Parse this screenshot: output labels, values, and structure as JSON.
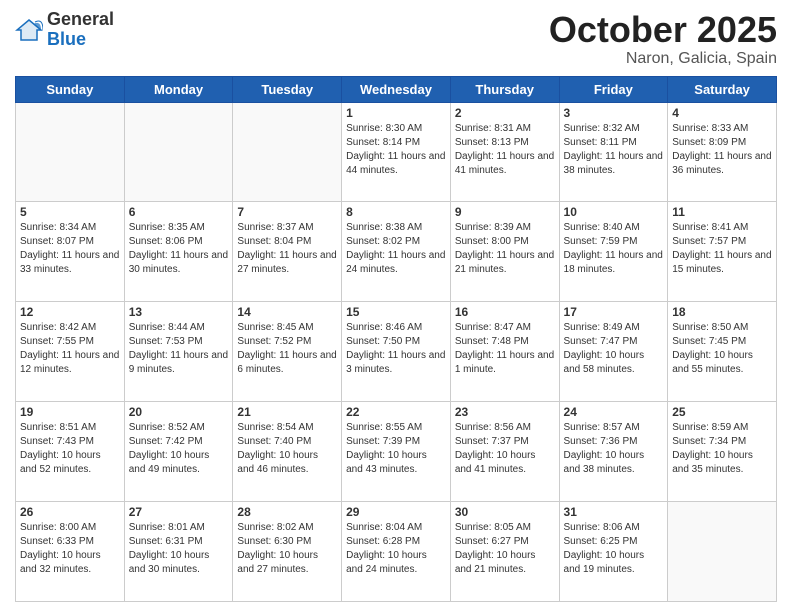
{
  "header": {
    "logo_general": "General",
    "logo_blue": "Blue",
    "title": "October 2025",
    "location": "Naron, Galicia, Spain"
  },
  "days_of_week": [
    "Sunday",
    "Monday",
    "Tuesday",
    "Wednesday",
    "Thursday",
    "Friday",
    "Saturday"
  ],
  "weeks": [
    [
      {
        "day": "",
        "info": ""
      },
      {
        "day": "",
        "info": ""
      },
      {
        "day": "",
        "info": ""
      },
      {
        "day": "1",
        "info": "Sunrise: 8:30 AM\nSunset: 8:14 PM\nDaylight: 11 hours and 44 minutes."
      },
      {
        "day": "2",
        "info": "Sunrise: 8:31 AM\nSunset: 8:13 PM\nDaylight: 11 hours and 41 minutes."
      },
      {
        "day": "3",
        "info": "Sunrise: 8:32 AM\nSunset: 8:11 PM\nDaylight: 11 hours and 38 minutes."
      },
      {
        "day": "4",
        "info": "Sunrise: 8:33 AM\nSunset: 8:09 PM\nDaylight: 11 hours and 36 minutes."
      }
    ],
    [
      {
        "day": "5",
        "info": "Sunrise: 8:34 AM\nSunset: 8:07 PM\nDaylight: 11 hours and 33 minutes."
      },
      {
        "day": "6",
        "info": "Sunrise: 8:35 AM\nSunset: 8:06 PM\nDaylight: 11 hours and 30 minutes."
      },
      {
        "day": "7",
        "info": "Sunrise: 8:37 AM\nSunset: 8:04 PM\nDaylight: 11 hours and 27 minutes."
      },
      {
        "day": "8",
        "info": "Sunrise: 8:38 AM\nSunset: 8:02 PM\nDaylight: 11 hours and 24 minutes."
      },
      {
        "day": "9",
        "info": "Sunrise: 8:39 AM\nSunset: 8:00 PM\nDaylight: 11 hours and 21 minutes."
      },
      {
        "day": "10",
        "info": "Sunrise: 8:40 AM\nSunset: 7:59 PM\nDaylight: 11 hours and 18 minutes."
      },
      {
        "day": "11",
        "info": "Sunrise: 8:41 AM\nSunset: 7:57 PM\nDaylight: 11 hours and 15 minutes."
      }
    ],
    [
      {
        "day": "12",
        "info": "Sunrise: 8:42 AM\nSunset: 7:55 PM\nDaylight: 11 hours and 12 minutes."
      },
      {
        "day": "13",
        "info": "Sunrise: 8:44 AM\nSunset: 7:53 PM\nDaylight: 11 hours and 9 minutes."
      },
      {
        "day": "14",
        "info": "Sunrise: 8:45 AM\nSunset: 7:52 PM\nDaylight: 11 hours and 6 minutes."
      },
      {
        "day": "15",
        "info": "Sunrise: 8:46 AM\nSunset: 7:50 PM\nDaylight: 11 hours and 3 minutes."
      },
      {
        "day": "16",
        "info": "Sunrise: 8:47 AM\nSunset: 7:48 PM\nDaylight: 11 hours and 1 minute."
      },
      {
        "day": "17",
        "info": "Sunrise: 8:49 AM\nSunset: 7:47 PM\nDaylight: 10 hours and 58 minutes."
      },
      {
        "day": "18",
        "info": "Sunrise: 8:50 AM\nSunset: 7:45 PM\nDaylight: 10 hours and 55 minutes."
      }
    ],
    [
      {
        "day": "19",
        "info": "Sunrise: 8:51 AM\nSunset: 7:43 PM\nDaylight: 10 hours and 52 minutes."
      },
      {
        "day": "20",
        "info": "Sunrise: 8:52 AM\nSunset: 7:42 PM\nDaylight: 10 hours and 49 minutes."
      },
      {
        "day": "21",
        "info": "Sunrise: 8:54 AM\nSunset: 7:40 PM\nDaylight: 10 hours and 46 minutes."
      },
      {
        "day": "22",
        "info": "Sunrise: 8:55 AM\nSunset: 7:39 PM\nDaylight: 10 hours and 43 minutes."
      },
      {
        "day": "23",
        "info": "Sunrise: 8:56 AM\nSunset: 7:37 PM\nDaylight: 10 hours and 41 minutes."
      },
      {
        "day": "24",
        "info": "Sunrise: 8:57 AM\nSunset: 7:36 PM\nDaylight: 10 hours and 38 minutes."
      },
      {
        "day": "25",
        "info": "Sunrise: 8:59 AM\nSunset: 7:34 PM\nDaylight: 10 hours and 35 minutes."
      }
    ],
    [
      {
        "day": "26",
        "info": "Sunrise: 8:00 AM\nSunset: 6:33 PM\nDaylight: 10 hours and 32 minutes."
      },
      {
        "day": "27",
        "info": "Sunrise: 8:01 AM\nSunset: 6:31 PM\nDaylight: 10 hours and 30 minutes."
      },
      {
        "day": "28",
        "info": "Sunrise: 8:02 AM\nSunset: 6:30 PM\nDaylight: 10 hours and 27 minutes."
      },
      {
        "day": "29",
        "info": "Sunrise: 8:04 AM\nSunset: 6:28 PM\nDaylight: 10 hours and 24 minutes."
      },
      {
        "day": "30",
        "info": "Sunrise: 8:05 AM\nSunset: 6:27 PM\nDaylight: 10 hours and 21 minutes."
      },
      {
        "day": "31",
        "info": "Sunrise: 8:06 AM\nSunset: 6:25 PM\nDaylight: 10 hours and 19 minutes."
      },
      {
        "day": "",
        "info": ""
      }
    ]
  ]
}
